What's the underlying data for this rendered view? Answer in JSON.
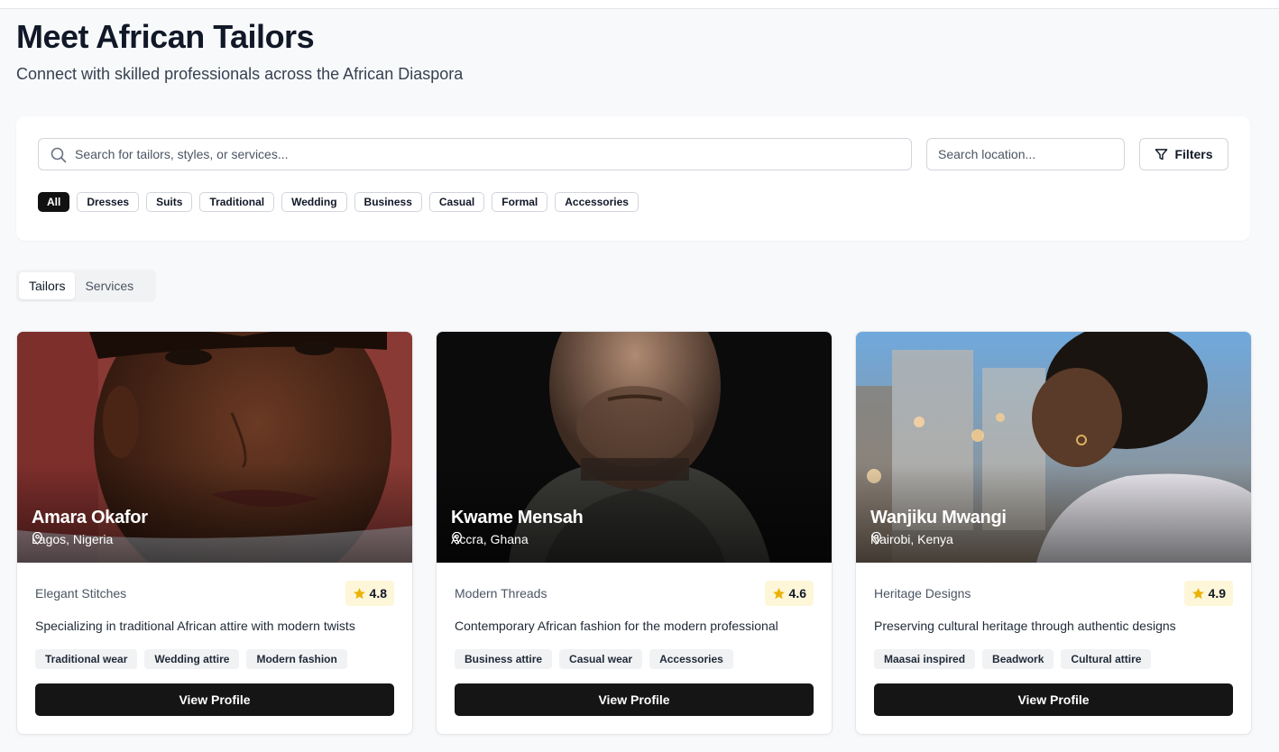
{
  "header": {
    "title": "Meet African Tailors",
    "subtitle": "Connect with skilled professionals across the African Diaspora"
  },
  "search": {
    "placeholder": "Search for tailors, styles, or services...",
    "location_placeholder": "Search location...",
    "filters_label": "Filters"
  },
  "categories": [
    {
      "label": "All",
      "active": true
    },
    {
      "label": "Dresses"
    },
    {
      "label": "Suits"
    },
    {
      "label": "Traditional"
    },
    {
      "label": "Wedding"
    },
    {
      "label": "Business"
    },
    {
      "label": "Casual"
    },
    {
      "label": "Formal"
    },
    {
      "label": "Accessories"
    }
  ],
  "tabs": [
    {
      "label": "Tailors",
      "active": true
    },
    {
      "label": "Services"
    }
  ],
  "tailors": [
    {
      "name": "Amara Okafor",
      "location": "Lagos, Nigeria",
      "business": "Elegant Stitches",
      "rating": "4.8",
      "description": "Specializing in traditional African attire with modern twists",
      "tags": [
        "Traditional wear",
        "Wedding attire",
        "Modern fashion"
      ],
      "button": "View Profile"
    },
    {
      "name": "Kwame Mensah",
      "location": "Accra, Ghana",
      "business": "Modern Threads",
      "rating": "4.6",
      "description": "Contemporary African fashion for the modern professional",
      "tags": [
        "Business attire",
        "Casual wear",
        "Accessories"
      ],
      "button": "View Profile"
    },
    {
      "name": "Wanjiku Mwangi",
      "location": "Nairobi, Kenya",
      "business": "Heritage Designs",
      "rating": "4.9",
      "description": "Preserving cultural heritage through authentic designs",
      "tags": [
        "Maasai inspired",
        "Beadwork",
        "Cultural attire"
      ],
      "button": "View Profile"
    }
  ],
  "colors": {
    "accent_dark": "#151515",
    "rating_bg": "#fdf6d8",
    "star": "#eab308"
  }
}
